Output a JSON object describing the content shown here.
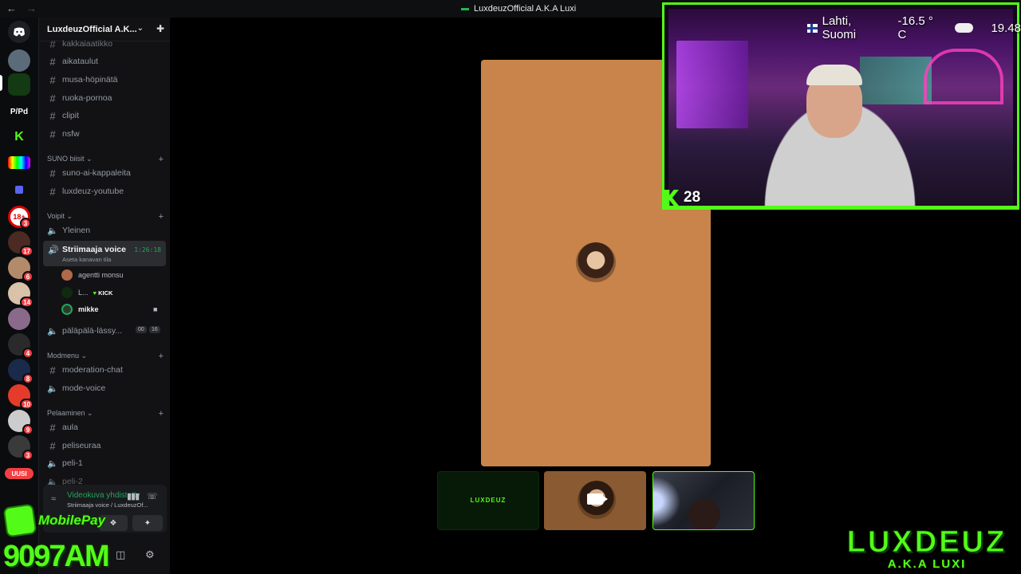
{
  "titlebar": {
    "title": "LuxdeuzOfficial A.K.A Luxi",
    "back": "←",
    "forward": "→"
  },
  "rail": {
    "servers": [
      {
        "label": "",
        "badge": ""
      },
      {
        "label": "",
        "badge": ""
      },
      {
        "label": "P/Pd",
        "badge": ""
      },
      {
        "label": "K",
        "badge": ""
      },
      {
        "label": "",
        "badge": ""
      },
      {
        "label": "",
        "badge": ""
      },
      {
        "label": "18+",
        "badge": "3"
      },
      {
        "label": "",
        "badge": "17"
      },
      {
        "label": "",
        "badge": "6"
      },
      {
        "label": "",
        "badge": "14"
      },
      {
        "label": "",
        "badge": ""
      },
      {
        "label": "",
        "badge": "4"
      },
      {
        "label": "",
        "badge": "8"
      },
      {
        "label": "",
        "badge": "10"
      },
      {
        "label": "",
        "badge": "9"
      },
      {
        "label": "",
        "badge": "3"
      }
    ],
    "new_label": "UUSI"
  },
  "sidebar": {
    "server_name": "LuxdeuzOfficial A.K...",
    "channels_top": [
      "kakkaiaatikko",
      "aikataulut",
      "musa-höpinätä",
      "ruoka-pornoa",
      "clipit",
      "nsfw"
    ],
    "cat_suno": "SUNO biisit",
    "suno_channels": [
      "suno-ai-kappaleita",
      "luxdeuz-youtube"
    ],
    "cat_voice": "Voipit",
    "voice_general": "Yleinen",
    "active_voice": {
      "name": "Striimaaja voice",
      "subtitle": "Aseta kanavan tila",
      "time": "1:26:18"
    },
    "members": [
      {
        "name": "agentti monsu"
      },
      {
        "name": "L...",
        "tag": "KICK"
      },
      {
        "name": "mikke"
      }
    ],
    "voice_palapala": "päläpälä-lässy...",
    "palapala_counts": [
      "00",
      "16"
    ],
    "cat_mod": "Modmenu",
    "mod_channels": [
      "moderation-chat"
    ],
    "mod_voice": "mode-voice",
    "cat_games": "Pelaaminen",
    "game_channels": [
      "aula",
      "peliseuraa"
    ],
    "game_voice": [
      "peli-1",
      "peli-2"
    ]
  },
  "voice_panel": {
    "status": "Videokuva yhdistetty",
    "subtitle": "Striimaaja voice / LuxdeuzOf..."
  },
  "overlay": {
    "mobilepay": "MobilePay",
    "clock": "9097AM",
    "weather": {
      "location": "Lahti, Suomi",
      "temp": "-16.5 ° C",
      "time": "19.48"
    },
    "kick_count": "28",
    "brand": "LUXDEUZ",
    "brand_sub": "A.K.A LUXI"
  },
  "stage": {
    "thumb_label": "LUXDEUZ"
  },
  "colors": {
    "accent": "#53fc18",
    "voice_green": "#23a55a",
    "tile_bg": "#c8844a"
  }
}
